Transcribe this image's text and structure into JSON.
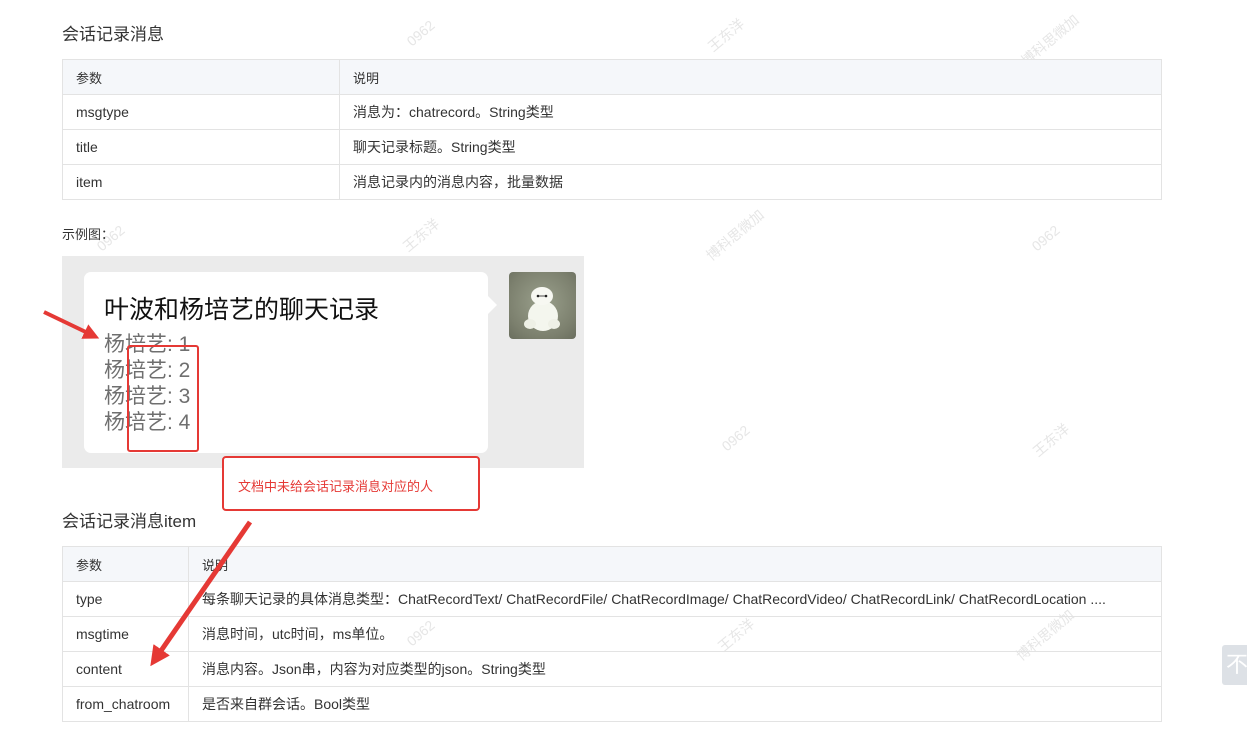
{
  "section1": {
    "title": "会话记录消息",
    "table": {
      "headers": [
        "参数",
        "说明"
      ],
      "rows": [
        [
          "msgtype",
          "消息为：chatrecord。String类型"
        ],
        [
          "title",
          "聊天记录标题。String类型"
        ],
        [
          "item",
          "消息记录内的消息内容，批量数据"
        ]
      ]
    }
  },
  "example": {
    "label": "示例图：",
    "bubble_title": "叶波和杨培艺的聊天记录",
    "lines": [
      "杨培艺: 1",
      "杨培艺: 2",
      "杨培艺: 3",
      "杨培艺: 4"
    ],
    "avatar_icon": "baymax-toy-avatar"
  },
  "annotation": {
    "text": "文档中未给会话记录消息对应的人",
    "color": "#e53935"
  },
  "section2": {
    "title": "会话记录消息item",
    "table": {
      "headers": [
        "参数",
        "说明"
      ],
      "rows": [
        [
          "type",
          "每条聊天记录的具体消息类型：ChatRecordText/ ChatRecordFile/ ChatRecordImage/ ChatRecordVideo/ ChatRecordLink/ ChatRecordLocation ...."
        ],
        [
          "msgtime",
          "消息时间，utc时间，ms单位。"
        ],
        [
          "content",
          "消息内容。Json串，内容为对应类型的json。String类型"
        ],
        [
          "from_chatroom",
          "是否来自群会话。Bool类型"
        ]
      ]
    }
  },
  "scroll_top": {
    "glyph": "不",
    "icon": "back-to-top-icon"
  },
  "watermarks": [
    "0962",
    "王东洋",
    "博科思微加"
  ]
}
